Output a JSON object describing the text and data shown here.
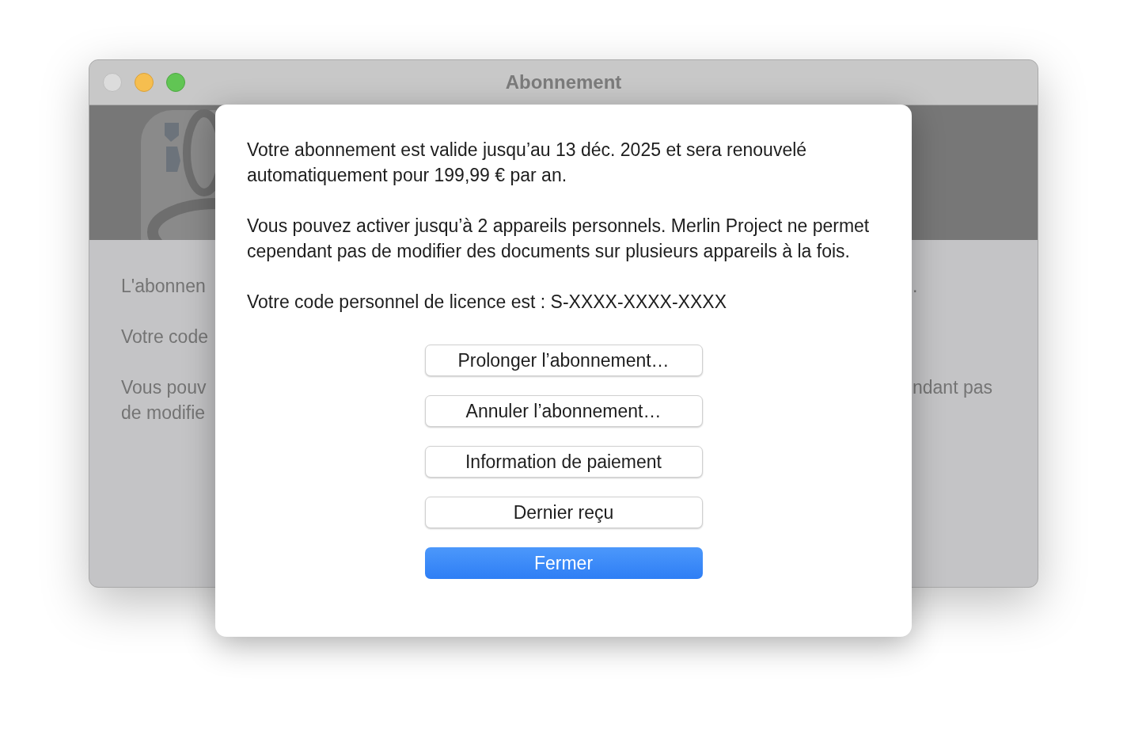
{
  "window": {
    "title": "Abonnement"
  },
  "background_text": {
    "left": [
      "L'abonnen",
      "Votre code",
      "Vous pouv\nde modifie"
    ],
    "right": [
      ".",
      "ndant pas"
    ]
  },
  "sheet": {
    "paragraphs": [
      "Votre abonnement est valide jusqu’au 13 déc. 2025 et sera renouvelé automatiquement pour 199,99 € par an.",
      "Vous pouvez activer jusqu’à 2 appareils personnels. Merlin Project ne permet cependant pas de modifier des documents sur plusieurs appareils à la fois.",
      "Votre code personnel de licence est : S-XXXX-XXXX-XXXX"
    ],
    "buttons": [
      {
        "label": "Prolonger l’abonnement…",
        "kind": "default"
      },
      {
        "label": "Annuler l’abonnement…",
        "kind": "default"
      },
      {
        "label": "Information de paiement",
        "kind": "default"
      },
      {
        "label": "Dernier reçu",
        "kind": "default"
      },
      {
        "label": "Fermer",
        "kind": "primary"
      }
    ]
  }
}
